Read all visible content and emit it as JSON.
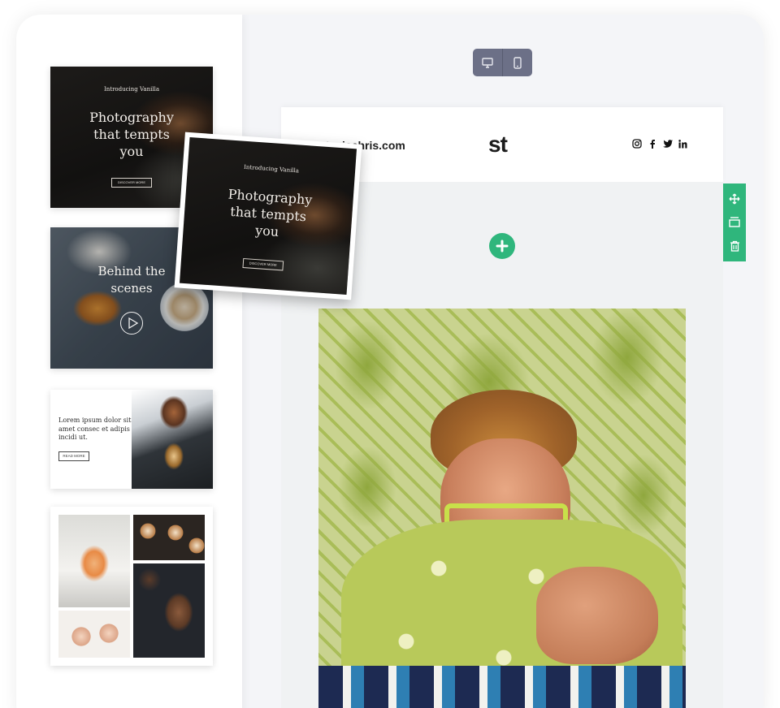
{
  "sidebar": {
    "templates": [
      {
        "kicker": "Introducing Vanilla",
        "title": "Photography that tempts you",
        "button": "DISCOVER MORE"
      },
      {
        "title": "Behind the scenes"
      },
      {
        "body": "Lorem ipsum dolor sit amet consec et adipis incidi ut.",
        "button": "READ MORE"
      },
      {}
    ]
  },
  "drag_card": {
    "kicker": "Introducing Vanilla",
    "title": "Photography that tempts you",
    "button": "DISCOVER MORE"
  },
  "device_toggle": {
    "options": [
      "desktop-icon",
      "mobile-icon"
    ],
    "selected": "desktop"
  },
  "email": {
    "header": {
      "domain": "steviechris.com",
      "logo": "st",
      "socials": [
        "instagram-icon",
        "facebook-icon",
        "twitter-icon",
        "linkedin-icon"
      ]
    }
  },
  "row_tools": [
    "move-icon",
    "duplicate-icon",
    "delete-icon"
  ],
  "colors": {
    "accent": "#2fb67c",
    "toggle": "#6c7087",
    "canvas": "#f4f5f8",
    "body": "#f0f2f3"
  }
}
